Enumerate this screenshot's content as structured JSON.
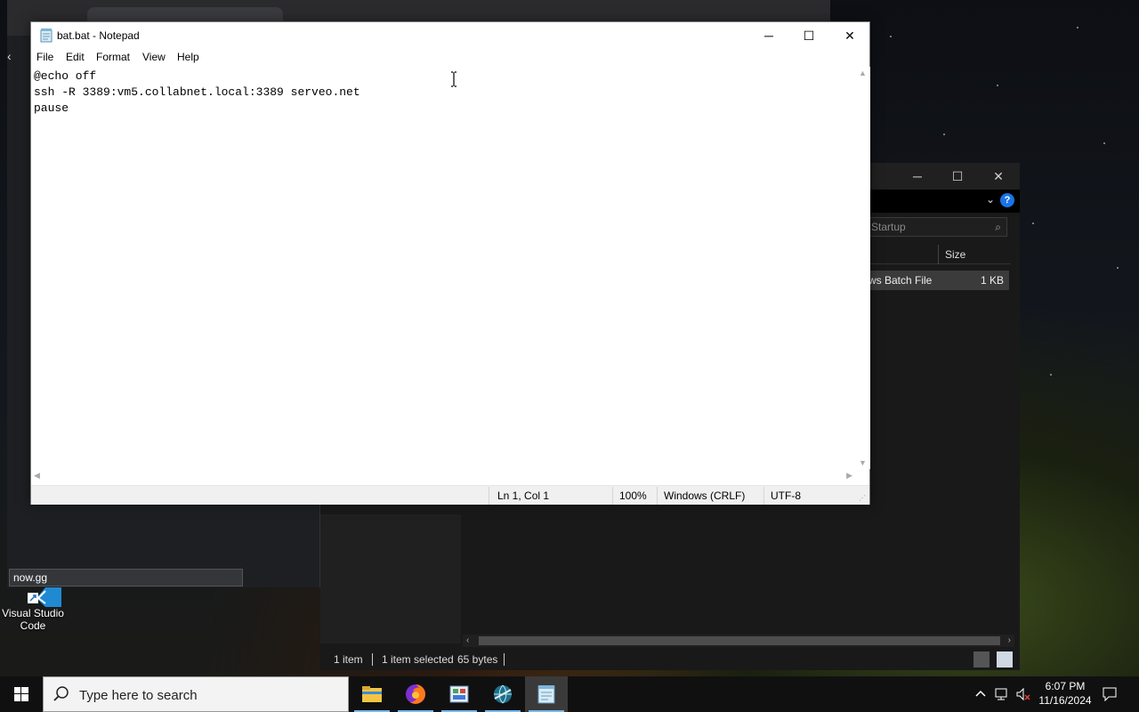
{
  "notepad": {
    "title": "bat.bat - Notepad",
    "menu": [
      "File",
      "Edit",
      "Format",
      "View",
      "Help"
    ],
    "content": "@echo off\nssh -R 3389:vm5.collabnet.local:3389 serveo.net\npause",
    "status": {
      "position": "Ln 1, Col 1",
      "zoom": "100%",
      "line_ending": "Windows (CRLF)",
      "encoding": "UTF-8"
    }
  },
  "explorer": {
    "search_placeholder": "Startup",
    "column_size": "Size",
    "file_type": "ws Batch File",
    "file_size": "1 KB",
    "status_items": "1 item",
    "status_selected": "1 item selected",
    "status_bytes": "65 bytes"
  },
  "browser": {
    "url_tooltip": "now.gg"
  },
  "desktop": {
    "icon_label": "Visual Studio Code"
  },
  "taskbar": {
    "search_placeholder": "Type here to search",
    "time": "6:07 PM",
    "date": "11/16/2024"
  }
}
